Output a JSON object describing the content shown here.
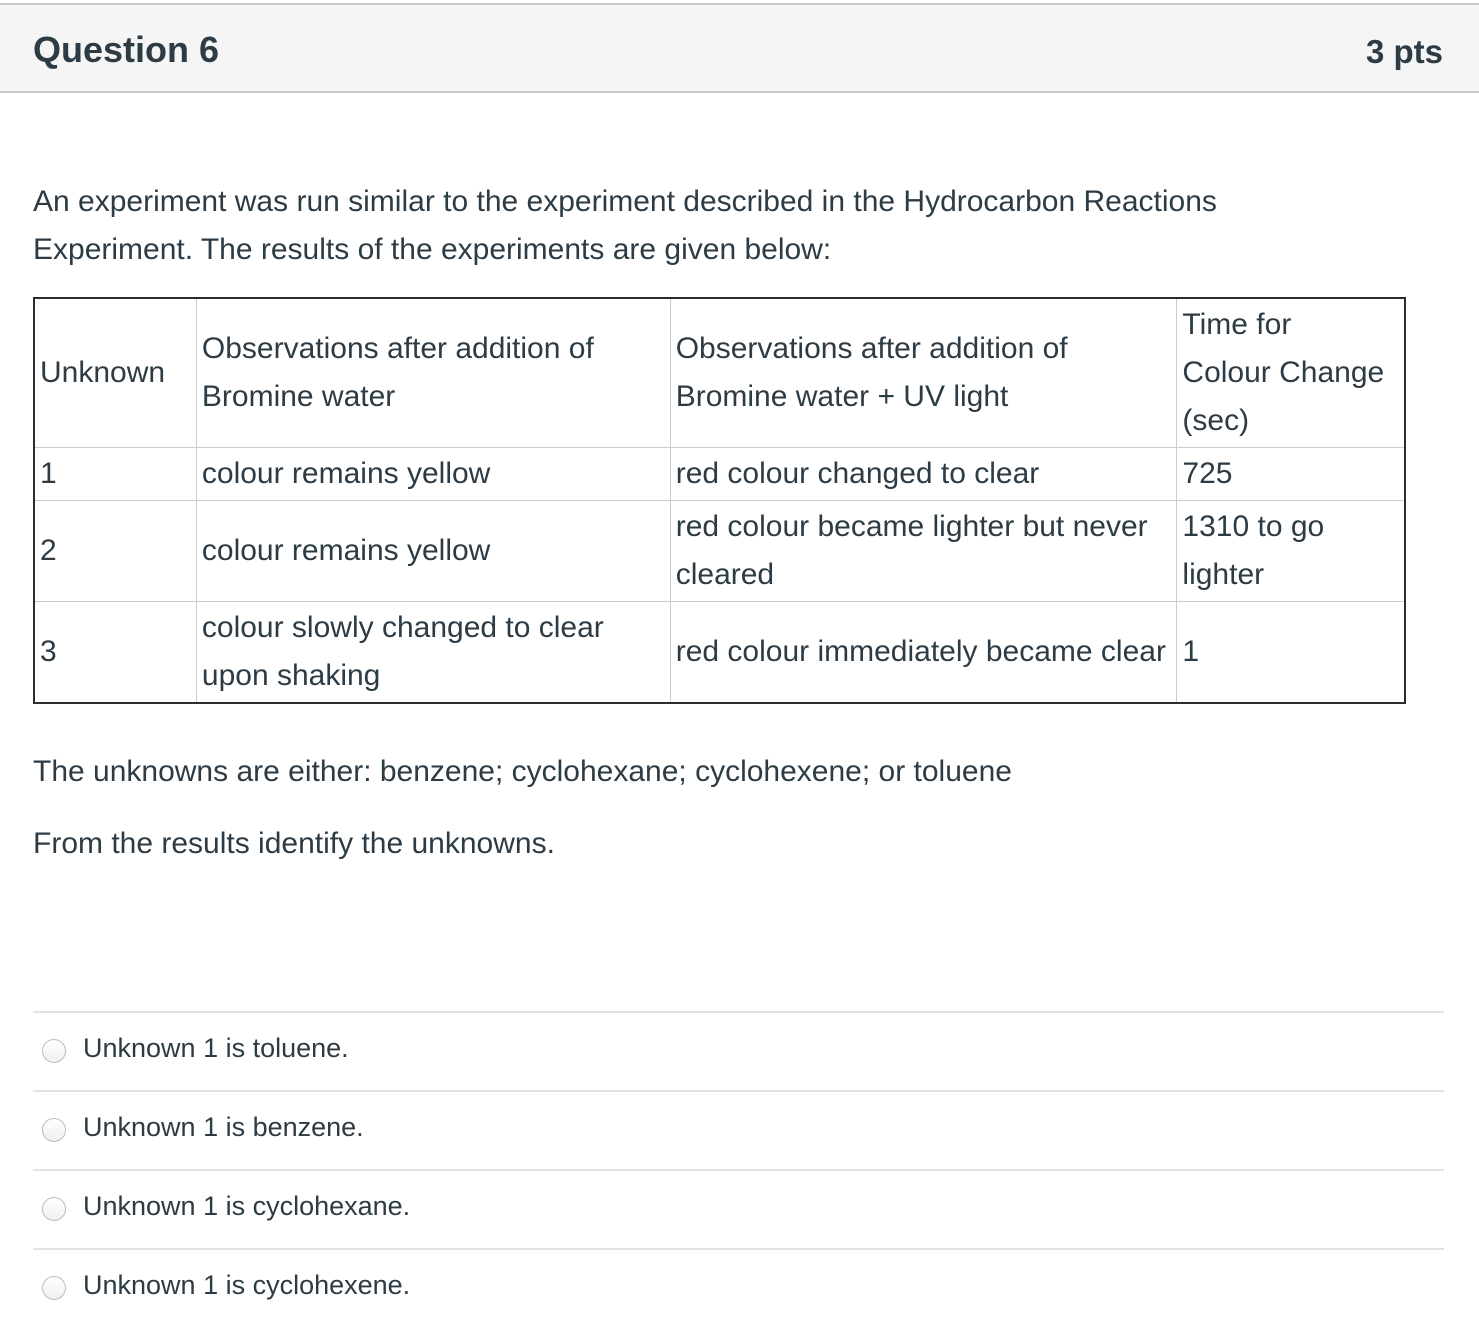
{
  "question": {
    "title": "Question 6",
    "points": "3 pts"
  },
  "intro": "An experiment was run similar to the experiment described in the Hydrocarbon Reactions Experiment.  The results of the experiments are given below:",
  "table": {
    "headers": {
      "unknown": "Unknown",
      "bromine_line1": "Observations after addition of",
      "bromine_line2": "Bromine water",
      "uv_line1": "Observations after addition of",
      "uv_line2": "Bromine water + UV light",
      "time_line1": "Time for",
      "time_line2": "Colour Change",
      "time_line3": "(sec)"
    },
    "rows": [
      {
        "unknown": "1",
        "bromine": "colour remains yellow",
        "uv": "red colour changed to clear",
        "time": "725"
      },
      {
        "unknown": "2",
        "bromine": "colour remains yellow",
        "uv": "red colour became lighter but never cleared",
        "time": "1310 to go lighter"
      },
      {
        "unknown": "3",
        "bromine": "colour slowly changed to clear upon shaking",
        "uv": "red colour immediately became clear",
        "time": "1"
      }
    ]
  },
  "tail_1": "The unknowns are either:  benzene; cyclohexane; cyclohexene; or toluene",
  "tail_2": "From the results identify the unknowns.",
  "answers": [
    {
      "label": "Unknown 1 is toluene."
    },
    {
      "label": "Unknown 1 is benzene."
    },
    {
      "label": "Unknown 1 is cyclohexane."
    },
    {
      "label": "Unknown 1 is cyclohexene."
    }
  ]
}
